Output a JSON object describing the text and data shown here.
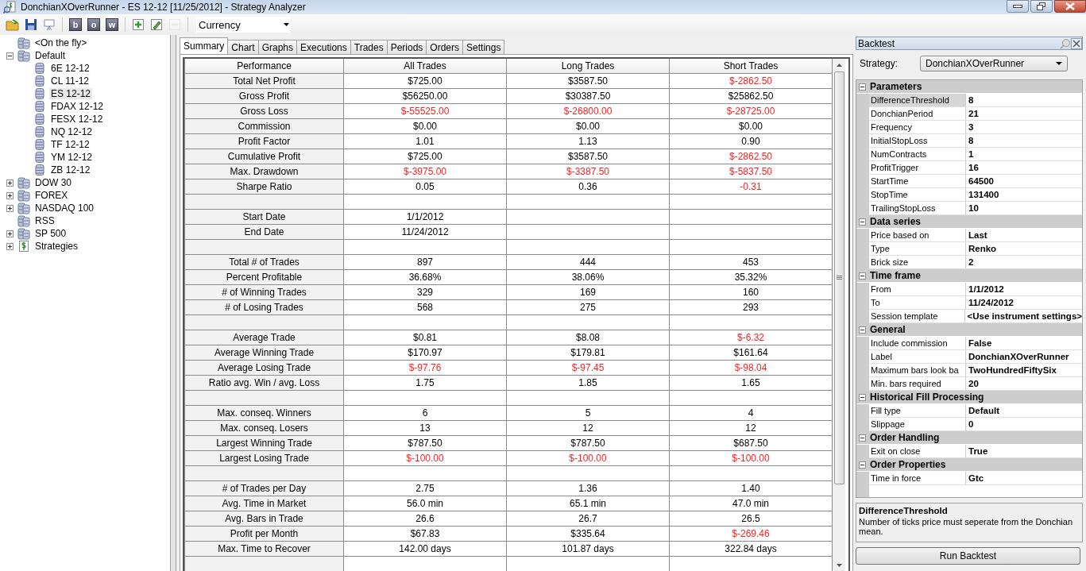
{
  "window": {
    "title": "DonchianXOverRunner - ES 12-12 [11/25/2012] - Strategy Analyzer"
  },
  "toolbar": {
    "buttons": [
      {
        "kind": "open",
        "disabled": false
      },
      {
        "kind": "save",
        "disabled": false
      },
      {
        "kind": "chart",
        "disabled": false
      },
      {
        "kind": "letter",
        "label": "b",
        "disabled": false
      },
      {
        "kind": "letter",
        "label": "o",
        "disabled": false
      },
      {
        "kind": "letter",
        "label": "w",
        "disabled": false
      },
      {
        "kind": "add",
        "disabled": false
      },
      {
        "kind": "edit",
        "disabled": false
      },
      {
        "kind": "remove",
        "disabled": true
      }
    ],
    "display_unit": "Currency"
  },
  "tree": [
    {
      "label": "<On the fly>",
      "kind": "list",
      "selected": false
    },
    {
      "label": "Default",
      "kind": "list",
      "selected": false,
      "expanded": true,
      "children": [
        {
          "label": "6E 12-12",
          "kind": "instrument",
          "selected": false
        },
        {
          "label": "CL 11-12",
          "kind": "instrument",
          "selected": false
        },
        {
          "label": "ES 12-12",
          "kind": "instrument",
          "selected": true
        },
        {
          "label": "FDAX 12-12",
          "kind": "instrument",
          "selected": false
        },
        {
          "label": "FESX 12-12",
          "kind": "instrument",
          "selected": false
        },
        {
          "label": "NQ 12-12",
          "kind": "instrument",
          "selected": false
        },
        {
          "label": "TF 12-12",
          "kind": "instrument",
          "selected": false
        },
        {
          "label": "YM 12-12",
          "kind": "instrument",
          "selected": false
        },
        {
          "label": "ZB 12-12",
          "kind": "instrument",
          "selected": false
        }
      ]
    },
    {
      "label": "DOW 30",
      "kind": "list",
      "selected": false,
      "expanded": false
    },
    {
      "label": "FOREX",
      "kind": "list",
      "selected": false,
      "expanded": false
    },
    {
      "label": "NASDAQ 100",
      "kind": "list",
      "selected": false,
      "expanded": false
    },
    {
      "label": "RSS",
      "kind": "list",
      "selected": false
    },
    {
      "label": "SP 500",
      "kind": "list",
      "selected": false,
      "expanded": false
    },
    {
      "label": "Strategies",
      "kind": "strategy",
      "selected": false,
      "expanded": false
    }
  ],
  "tabs": [
    {
      "label": "Summary",
      "selected": true
    },
    {
      "label": "Chart",
      "selected": false
    },
    {
      "label": "Graphs",
      "selected": false
    },
    {
      "label": "Executions",
      "selected": false
    },
    {
      "label": "Trades",
      "selected": false
    },
    {
      "label": "Periods",
      "selected": false
    },
    {
      "label": "Orders",
      "selected": false
    },
    {
      "label": "Settings",
      "selected": false
    }
  ],
  "table": {
    "columns": [
      "Performance",
      "All Trades",
      "Long Trades",
      "Short Trades"
    ],
    "rows": [
      {
        "label": "Total Net Profit",
        "values": [
          {
            "text": "$725.00",
            "negative": false
          },
          {
            "text": "$3587.50",
            "negative": false
          },
          {
            "text": "$-2862.50",
            "negative": true
          }
        ]
      },
      {
        "label": "Gross Profit",
        "values": [
          {
            "text": "$56250.00",
            "negative": false
          },
          {
            "text": "$30387.50",
            "negative": false
          },
          {
            "text": "$25862.50",
            "negative": false
          }
        ]
      },
      {
        "label": "Gross Loss",
        "values": [
          {
            "text": "$-55525.00",
            "negative": true
          },
          {
            "text": "$-26800.00",
            "negative": true
          },
          {
            "text": "$-28725.00",
            "negative": true
          }
        ]
      },
      {
        "label": "Commission",
        "values": [
          {
            "text": "$0.00",
            "negative": false
          },
          {
            "text": "$0.00",
            "negative": false
          },
          {
            "text": "$0.00",
            "negative": false
          }
        ]
      },
      {
        "label": "Profit Factor",
        "values": [
          {
            "text": "1.01",
            "negative": false
          },
          {
            "text": "1.13",
            "negative": false
          },
          {
            "text": "0.90",
            "negative": false
          }
        ]
      },
      {
        "label": "Cumulative Profit",
        "values": [
          {
            "text": "$725.00",
            "negative": false
          },
          {
            "text": "$3587.50",
            "negative": false
          },
          {
            "text": "$-2862.50",
            "negative": true
          }
        ]
      },
      {
        "label": "Max. Drawdown",
        "values": [
          {
            "text": "$-3975.00",
            "negative": true
          },
          {
            "text": "$-3387.50",
            "negative": true
          },
          {
            "text": "$-5837.50",
            "negative": true
          }
        ]
      },
      {
        "label": "Sharpe Ratio",
        "values": [
          {
            "text": "0.05",
            "negative": false
          },
          {
            "text": "0.36",
            "negative": false
          },
          {
            "text": "-0.31",
            "negative": true
          }
        ]
      },
      {
        "label": null,
        "values": []
      },
      {
        "label": "Start Date",
        "values": [
          {
            "text": "1/1/2012",
            "negative": false
          }
        ]
      },
      {
        "label": "End Date",
        "values": [
          {
            "text": "11/24/2012",
            "negative": false
          }
        ]
      },
      {
        "label": null,
        "values": []
      },
      {
        "label": "Total # of Trades",
        "values": [
          {
            "text": "897",
            "negative": false
          },
          {
            "text": "444",
            "negative": false
          },
          {
            "text": "453",
            "negative": false
          }
        ]
      },
      {
        "label": "Percent Profitable",
        "values": [
          {
            "text": "36.68%",
            "negative": false
          },
          {
            "text": "38.06%",
            "negative": false
          },
          {
            "text": "35.32%",
            "negative": false
          }
        ]
      },
      {
        "label": "# of Winning Trades",
        "values": [
          {
            "text": "329",
            "negative": false
          },
          {
            "text": "169",
            "negative": false
          },
          {
            "text": "160",
            "negative": false
          }
        ]
      },
      {
        "label": "# of Losing Trades",
        "values": [
          {
            "text": "568",
            "negative": false
          },
          {
            "text": "275",
            "negative": false
          },
          {
            "text": "293",
            "negative": false
          }
        ]
      },
      {
        "label": null,
        "values": []
      },
      {
        "label": "Average Trade",
        "values": [
          {
            "text": "$0.81",
            "negative": false
          },
          {
            "text": "$8.08",
            "negative": false
          },
          {
            "text": "$-6.32",
            "negative": true
          }
        ]
      },
      {
        "label": "Average Winning Trade",
        "values": [
          {
            "text": "$170.97",
            "negative": false
          },
          {
            "text": "$179.81",
            "negative": false
          },
          {
            "text": "$161.64",
            "negative": false
          }
        ]
      },
      {
        "label": "Average Losing Trade",
        "values": [
          {
            "text": "$-97.76",
            "negative": true
          },
          {
            "text": "$-97.45",
            "negative": true
          },
          {
            "text": "$-98.04",
            "negative": true
          }
        ]
      },
      {
        "label": "Ratio avg. Win / avg. Loss",
        "values": [
          {
            "text": "1.75",
            "negative": false
          },
          {
            "text": "1.85",
            "negative": false
          },
          {
            "text": "1.65",
            "negative": false
          }
        ]
      },
      {
        "label": null,
        "values": []
      },
      {
        "label": "Max. conseq. Winners",
        "values": [
          {
            "text": "6",
            "negative": false
          },
          {
            "text": "5",
            "negative": false
          },
          {
            "text": "4",
            "negative": false
          }
        ]
      },
      {
        "label": "Max. conseq. Losers",
        "values": [
          {
            "text": "13",
            "negative": false
          },
          {
            "text": "12",
            "negative": false
          },
          {
            "text": "12",
            "negative": false
          }
        ]
      },
      {
        "label": "Largest Winning Trade",
        "values": [
          {
            "text": "$787.50",
            "negative": false
          },
          {
            "text": "$787.50",
            "negative": false
          },
          {
            "text": "$687.50",
            "negative": false
          }
        ]
      },
      {
        "label": "Largest Losing Trade",
        "values": [
          {
            "text": "$-100.00",
            "negative": true
          },
          {
            "text": "$-100.00",
            "negative": true
          },
          {
            "text": "$-100.00",
            "negative": true
          }
        ]
      },
      {
        "label": null,
        "values": []
      },
      {
        "label": "# of Trades per Day",
        "values": [
          {
            "text": "2.75",
            "negative": false
          },
          {
            "text": "1.36",
            "negative": false
          },
          {
            "text": "1.40",
            "negative": false
          }
        ]
      },
      {
        "label": "Avg. Time in Market",
        "values": [
          {
            "text": "56.0 min",
            "negative": false
          },
          {
            "text": "65.1 min",
            "negative": false
          },
          {
            "text": "47.0 min",
            "negative": false
          }
        ]
      },
      {
        "label": "Avg. Bars in Trade",
        "values": [
          {
            "text": "26.6",
            "negative": false
          },
          {
            "text": "26.7",
            "negative": false
          },
          {
            "text": "26.5",
            "negative": false
          }
        ]
      },
      {
        "label": "Profit per Month",
        "values": [
          {
            "text": "$67.83",
            "negative": false
          },
          {
            "text": "$335.64",
            "negative": false
          },
          {
            "text": "$-269.46",
            "negative": true
          }
        ]
      },
      {
        "label": "Max. Time to Recover",
        "values": [
          {
            "text": "142.00 days",
            "negative": false
          },
          {
            "text": "101.87 days",
            "negative": false
          },
          {
            "text": "322.84 days",
            "negative": false
          }
        ]
      },
      {
        "label": null,
        "values": []
      }
    ]
  },
  "backtest": {
    "title": "Backtest",
    "strategy_label": "Strategy:",
    "strategy": "DonchianXOverRunner",
    "categories": [
      {
        "name": "Parameters",
        "expanded": true,
        "properties": [
          {
            "name": "DifferenceThreshold",
            "value": "8",
            "selected": true
          },
          {
            "name": "DonchianPeriod",
            "value": "21",
            "selected": false
          },
          {
            "name": "Frequency",
            "value": "3",
            "selected": false
          },
          {
            "name": "InitialStopLoss",
            "value": "8",
            "selected": false
          },
          {
            "name": "NumContracts",
            "value": "1",
            "selected": false
          },
          {
            "name": "ProfitTrigger",
            "value": "16",
            "selected": false
          },
          {
            "name": "StartTime",
            "value": "64500",
            "selected": false
          },
          {
            "name": "StopTime",
            "value": "131400",
            "selected": false
          },
          {
            "name": "TrailingStopLoss",
            "value": "10",
            "selected": false
          }
        ]
      },
      {
        "name": "Data series",
        "expanded": true,
        "properties": [
          {
            "name": "Price based on",
            "value": "Last",
            "selected": false
          },
          {
            "name": "Type",
            "value": "Renko",
            "selected": false
          },
          {
            "name": "Brick size",
            "value": "2",
            "selected": false
          }
        ]
      },
      {
        "name": "Time frame",
        "expanded": true,
        "properties": [
          {
            "name": "From",
            "value": "1/1/2012",
            "selected": false
          },
          {
            "name": "To",
            "value": "11/24/2012",
            "selected": false
          },
          {
            "name": "Session template",
            "value": "<Use instrument settings>",
            "selected": false
          }
        ]
      },
      {
        "name": "General",
        "expanded": true,
        "properties": [
          {
            "name": "Include commission",
            "value": "False",
            "selected": false
          },
          {
            "name": "Label",
            "value": "DonchianXOverRunner",
            "selected": false
          },
          {
            "name": "Maximum bars look ba",
            "value": "TwoHundredFiftySix",
            "selected": false
          },
          {
            "name": "Min. bars required",
            "value": "20",
            "selected": false
          }
        ]
      },
      {
        "name": "Historical Fill Processing",
        "expanded": true,
        "properties": [
          {
            "name": "Fill type",
            "value": "Default",
            "selected": false
          },
          {
            "name": "Slippage",
            "value": "0",
            "selected": false
          }
        ]
      },
      {
        "name": "Order Handling",
        "expanded": true,
        "properties": [
          {
            "name": "Exit on close",
            "value": "True",
            "selected": false
          }
        ]
      },
      {
        "name": "Order Properties",
        "expanded": true,
        "properties": [
          {
            "name": "Time in force",
            "value": "Gtc",
            "selected": false
          }
        ]
      }
    ],
    "description": {
      "title": "DifferenceThreshold",
      "text": "Number of ticks price must seperate from the Donchian mean."
    },
    "run_button": "Run Backtest"
  }
}
